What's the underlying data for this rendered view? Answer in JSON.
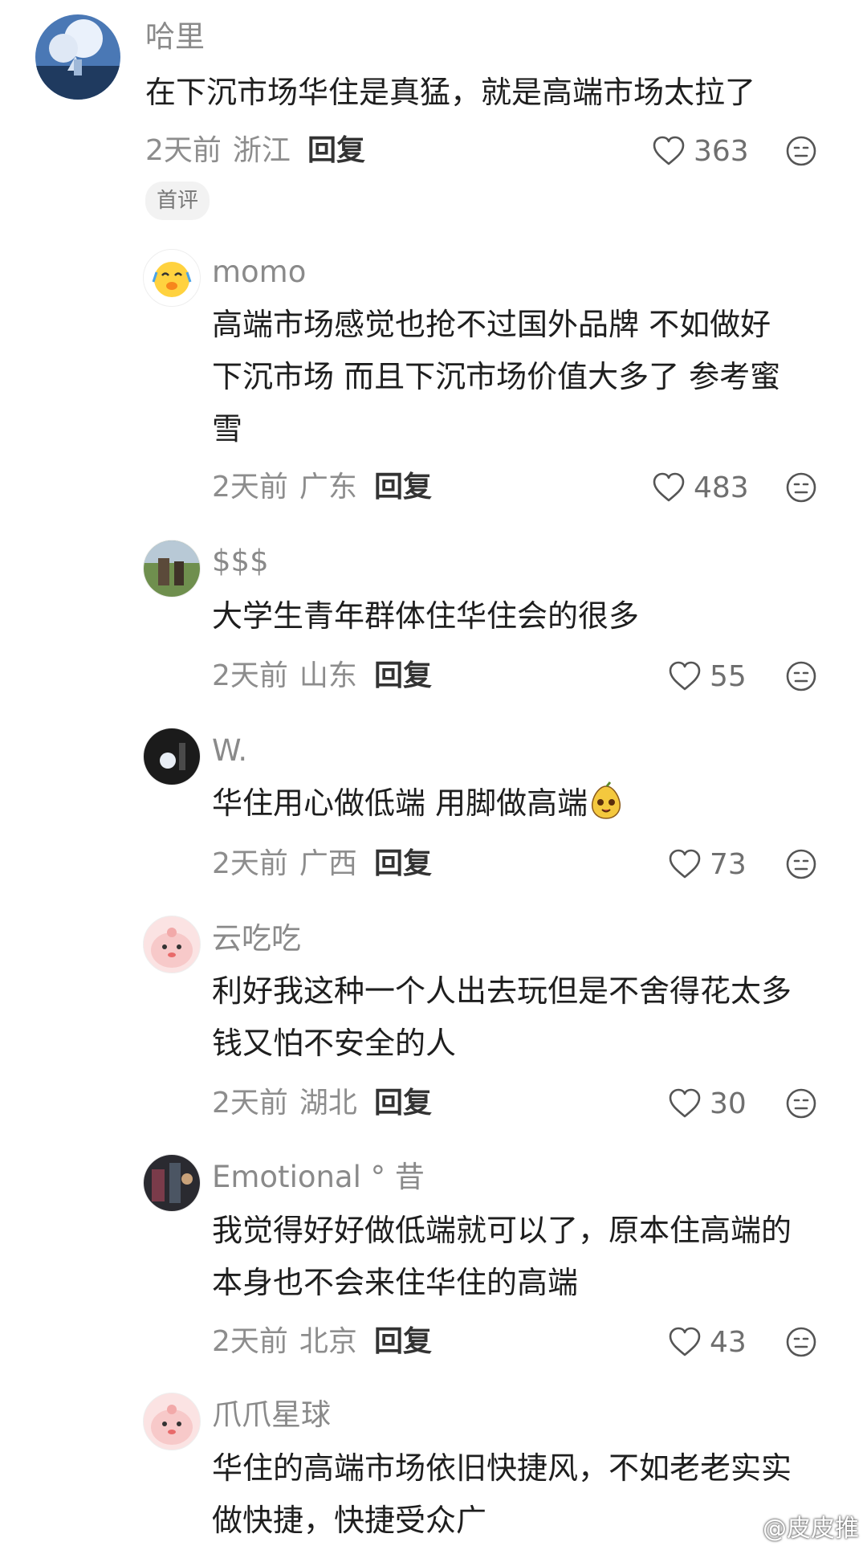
{
  "comments": [
    {
      "name": "哈里",
      "text": "在下沉市场华住是真猛，就是高端市场太拉了",
      "time": "2天前",
      "location": "浙江",
      "reply": "回复",
      "likes": "363",
      "badge": "首评",
      "avatar_icon": "landscape-avatar-icon"
    },
    {
      "name": "momo",
      "text": "高端市场感觉也抢不过国外品牌 不如做好\n下沉市场 而且下沉市场价值大多了 参考蜜\n雪",
      "time": "2天前",
      "location": "广东",
      "reply": "回复",
      "likes": "483",
      "avatar_icon": "laughing-emoji-avatar-icon"
    },
    {
      "name": "$$$",
      "text": "大学生青年群体住华住会的很多",
      "time": "2天前",
      "location": "山东",
      "reply": "回复",
      "likes": "55",
      "avatar_icon": "photo-avatar-icon"
    },
    {
      "name": "W.",
      "text": "华住用心做低端 用脚做高端",
      "time": "2天前",
      "location": "广西",
      "reply": "回复",
      "likes": "73",
      "avatar_icon": "dark-photo-avatar-icon",
      "sticker_icon": "smiling-pear-sticker-icon"
    },
    {
      "name": "云吃吃",
      "text": "利好我这种一个人出去玩但是不舍得花太多\n钱又怕不安全的人",
      "time": "2天前",
      "location": "湖北",
      "reply": "回复",
      "likes": "30",
      "avatar_icon": "pink-blob-avatar-icon"
    },
    {
      "name": "Emotional °  昔",
      "text": "我觉得好好做低端就可以了，原本住高端的\n本身也不会来住华住的高端",
      "time": "2天前",
      "location": "北京",
      "reply": "回复",
      "likes": "43",
      "avatar_icon": "dark-photo-avatar-icon"
    },
    {
      "name": "爪爪星球",
      "text": "华住的高端市场依旧快捷风，不如老老实实\n做快捷，快捷受众广",
      "avatar_icon": "pink-blob-avatar-icon"
    }
  ],
  "watermark": {
    "text": "@皮皮推",
    "icon": "weibo-icon"
  },
  "colors": {
    "muted": "#8d8d8d",
    "text": "#1e1e1e",
    "badge_bg": "#f2f2f2"
  }
}
